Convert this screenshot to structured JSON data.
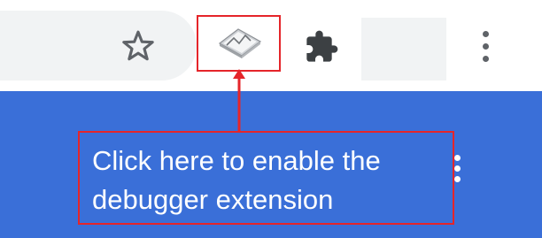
{
  "toolbar": {
    "bookmark_icon": "star-outline-icon",
    "extension_icon": "debugger-extension-icon",
    "extensions_menu_icon": "puzzle-piece-icon",
    "menu_icon": "three-dots-vertical-icon"
  },
  "annotation": {
    "text": "Click here to enable the\ndebugger extension",
    "color": "#e5252a"
  },
  "colors": {
    "page_background": "#3a6fd8",
    "toolbar_background": "#ffffff",
    "address_bar": "#f1f3f4",
    "icon": "#5f6368"
  }
}
